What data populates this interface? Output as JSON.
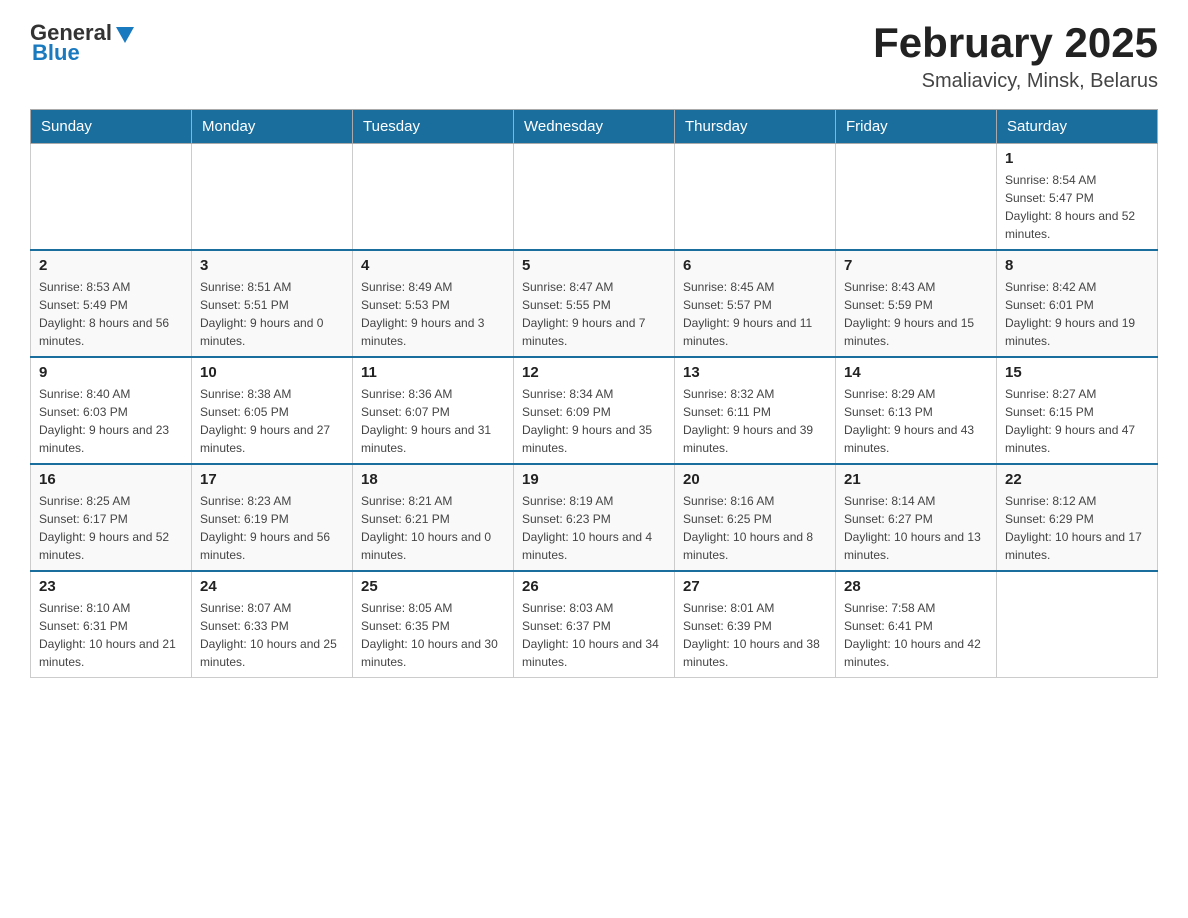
{
  "header": {
    "logo": {
      "general": "General",
      "blue": "Blue"
    },
    "title": "February 2025",
    "location": "Smaliavicy, Minsk, Belarus"
  },
  "days_of_week": [
    "Sunday",
    "Monday",
    "Tuesday",
    "Wednesday",
    "Thursday",
    "Friday",
    "Saturday"
  ],
  "weeks": [
    [
      {
        "day": "",
        "info": ""
      },
      {
        "day": "",
        "info": ""
      },
      {
        "day": "",
        "info": ""
      },
      {
        "day": "",
        "info": ""
      },
      {
        "day": "",
        "info": ""
      },
      {
        "day": "",
        "info": ""
      },
      {
        "day": "1",
        "info": "Sunrise: 8:54 AM\nSunset: 5:47 PM\nDaylight: 8 hours and 52 minutes."
      }
    ],
    [
      {
        "day": "2",
        "info": "Sunrise: 8:53 AM\nSunset: 5:49 PM\nDaylight: 8 hours and 56 minutes."
      },
      {
        "day": "3",
        "info": "Sunrise: 8:51 AM\nSunset: 5:51 PM\nDaylight: 9 hours and 0 minutes."
      },
      {
        "day": "4",
        "info": "Sunrise: 8:49 AM\nSunset: 5:53 PM\nDaylight: 9 hours and 3 minutes."
      },
      {
        "day": "5",
        "info": "Sunrise: 8:47 AM\nSunset: 5:55 PM\nDaylight: 9 hours and 7 minutes."
      },
      {
        "day": "6",
        "info": "Sunrise: 8:45 AM\nSunset: 5:57 PM\nDaylight: 9 hours and 11 minutes."
      },
      {
        "day": "7",
        "info": "Sunrise: 8:43 AM\nSunset: 5:59 PM\nDaylight: 9 hours and 15 minutes."
      },
      {
        "day": "8",
        "info": "Sunrise: 8:42 AM\nSunset: 6:01 PM\nDaylight: 9 hours and 19 minutes."
      }
    ],
    [
      {
        "day": "9",
        "info": "Sunrise: 8:40 AM\nSunset: 6:03 PM\nDaylight: 9 hours and 23 minutes."
      },
      {
        "day": "10",
        "info": "Sunrise: 8:38 AM\nSunset: 6:05 PM\nDaylight: 9 hours and 27 minutes."
      },
      {
        "day": "11",
        "info": "Sunrise: 8:36 AM\nSunset: 6:07 PM\nDaylight: 9 hours and 31 minutes."
      },
      {
        "day": "12",
        "info": "Sunrise: 8:34 AM\nSunset: 6:09 PM\nDaylight: 9 hours and 35 minutes."
      },
      {
        "day": "13",
        "info": "Sunrise: 8:32 AM\nSunset: 6:11 PM\nDaylight: 9 hours and 39 minutes."
      },
      {
        "day": "14",
        "info": "Sunrise: 8:29 AM\nSunset: 6:13 PM\nDaylight: 9 hours and 43 minutes."
      },
      {
        "day": "15",
        "info": "Sunrise: 8:27 AM\nSunset: 6:15 PM\nDaylight: 9 hours and 47 minutes."
      }
    ],
    [
      {
        "day": "16",
        "info": "Sunrise: 8:25 AM\nSunset: 6:17 PM\nDaylight: 9 hours and 52 minutes."
      },
      {
        "day": "17",
        "info": "Sunrise: 8:23 AM\nSunset: 6:19 PM\nDaylight: 9 hours and 56 minutes."
      },
      {
        "day": "18",
        "info": "Sunrise: 8:21 AM\nSunset: 6:21 PM\nDaylight: 10 hours and 0 minutes."
      },
      {
        "day": "19",
        "info": "Sunrise: 8:19 AM\nSunset: 6:23 PM\nDaylight: 10 hours and 4 minutes."
      },
      {
        "day": "20",
        "info": "Sunrise: 8:16 AM\nSunset: 6:25 PM\nDaylight: 10 hours and 8 minutes."
      },
      {
        "day": "21",
        "info": "Sunrise: 8:14 AM\nSunset: 6:27 PM\nDaylight: 10 hours and 13 minutes."
      },
      {
        "day": "22",
        "info": "Sunrise: 8:12 AM\nSunset: 6:29 PM\nDaylight: 10 hours and 17 minutes."
      }
    ],
    [
      {
        "day": "23",
        "info": "Sunrise: 8:10 AM\nSunset: 6:31 PM\nDaylight: 10 hours and 21 minutes."
      },
      {
        "day": "24",
        "info": "Sunrise: 8:07 AM\nSunset: 6:33 PM\nDaylight: 10 hours and 25 minutes."
      },
      {
        "day": "25",
        "info": "Sunrise: 8:05 AM\nSunset: 6:35 PM\nDaylight: 10 hours and 30 minutes."
      },
      {
        "day": "26",
        "info": "Sunrise: 8:03 AM\nSunset: 6:37 PM\nDaylight: 10 hours and 34 minutes."
      },
      {
        "day": "27",
        "info": "Sunrise: 8:01 AM\nSunset: 6:39 PM\nDaylight: 10 hours and 38 minutes."
      },
      {
        "day": "28",
        "info": "Sunrise: 7:58 AM\nSunset: 6:41 PM\nDaylight: 10 hours and 42 minutes."
      },
      {
        "day": "",
        "info": ""
      }
    ]
  ]
}
